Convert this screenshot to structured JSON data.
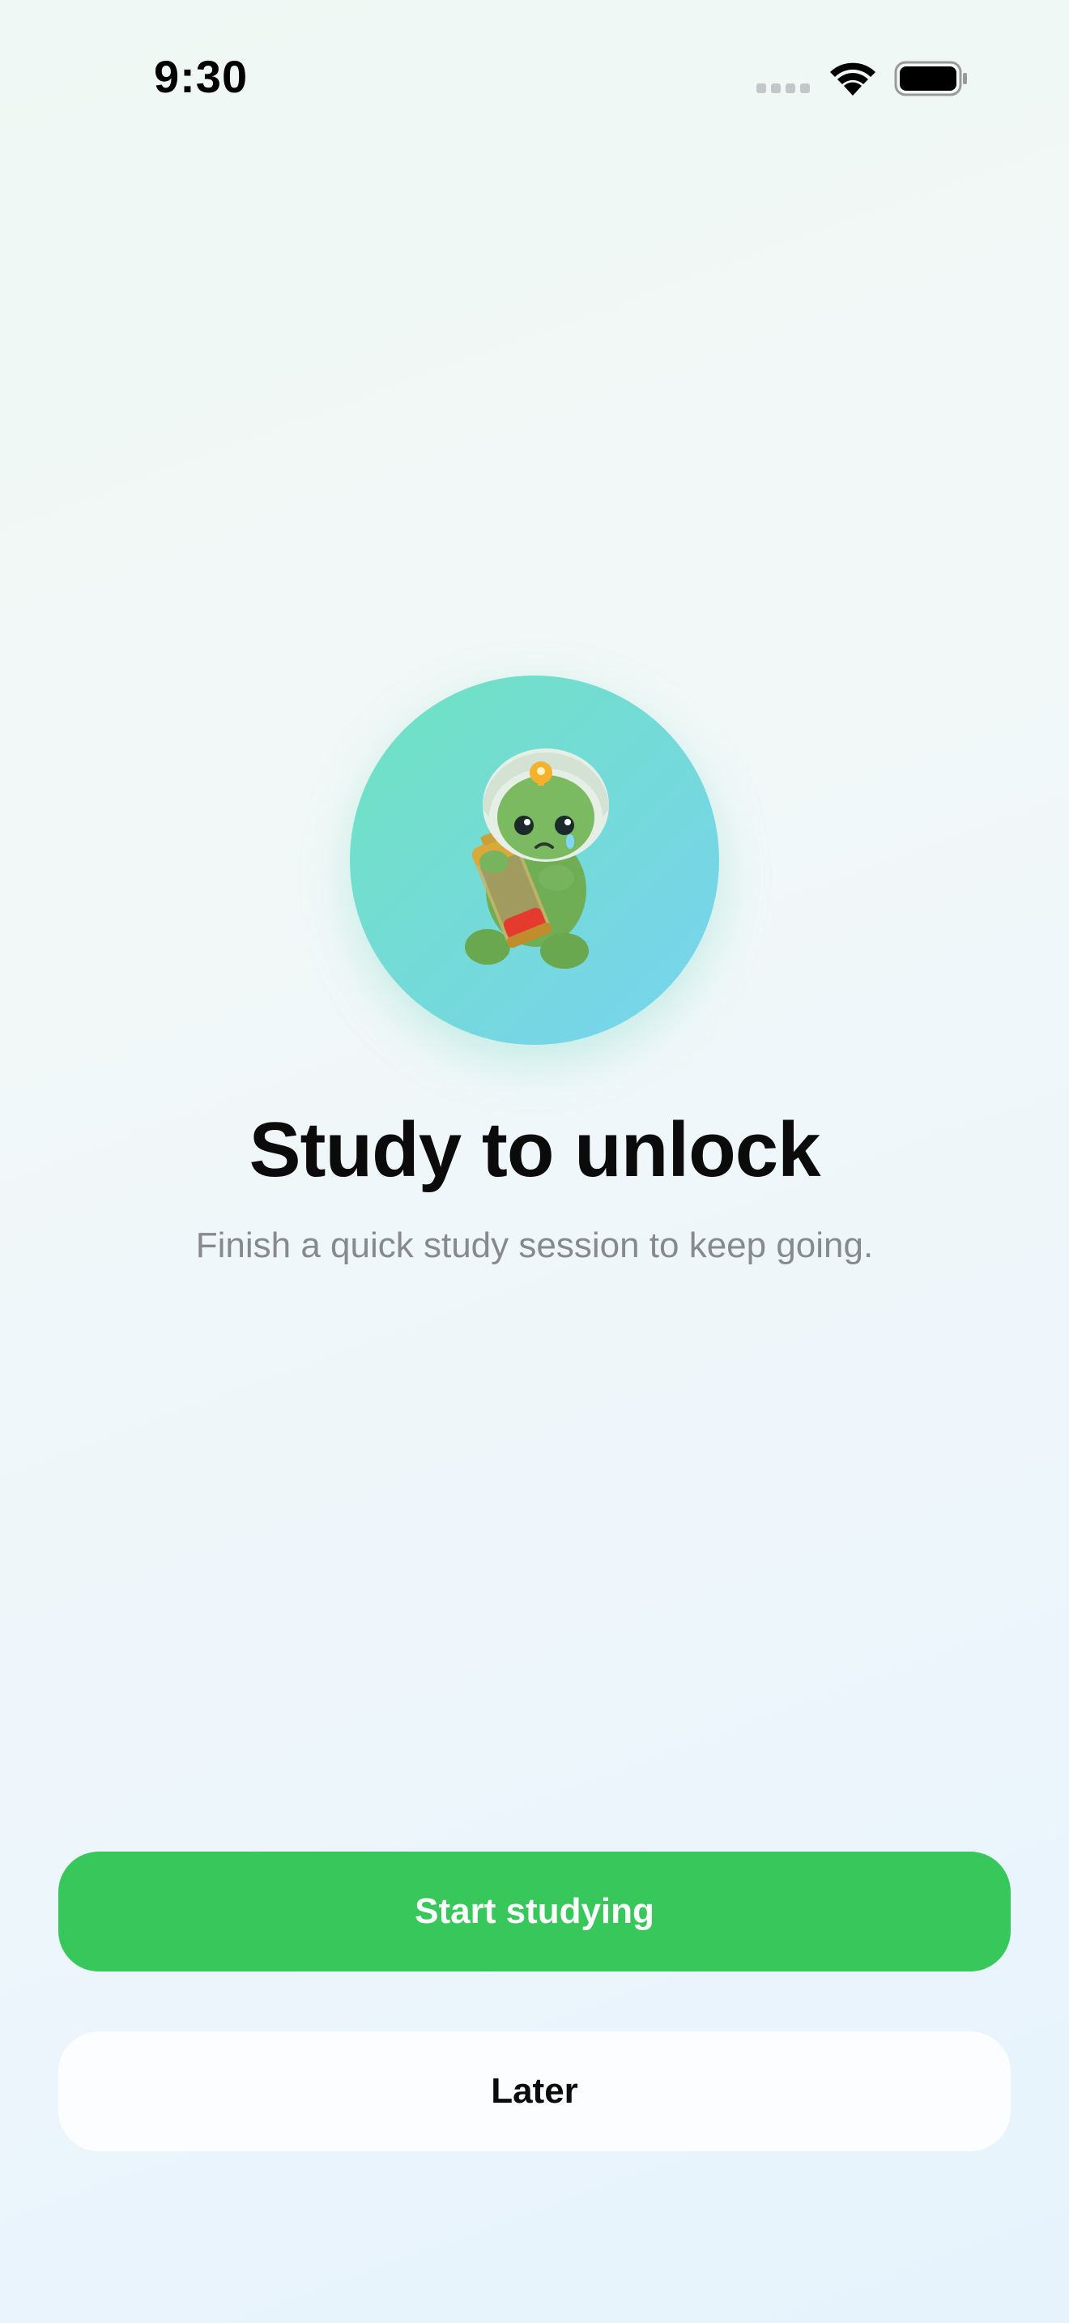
{
  "status_bar": {
    "time": "9:30"
  },
  "hero": {
    "illustration": "sad-mascot-helmet-battery",
    "circle_colors": [
      "#6fe3c0",
      "#78d3f0"
    ]
  },
  "content": {
    "title": "Study to unlock",
    "subtitle": "Finish a quick study session to keep going."
  },
  "actions": {
    "primary_label": "Start studying",
    "primary_color": "#37c75b",
    "secondary_label": "Later"
  }
}
